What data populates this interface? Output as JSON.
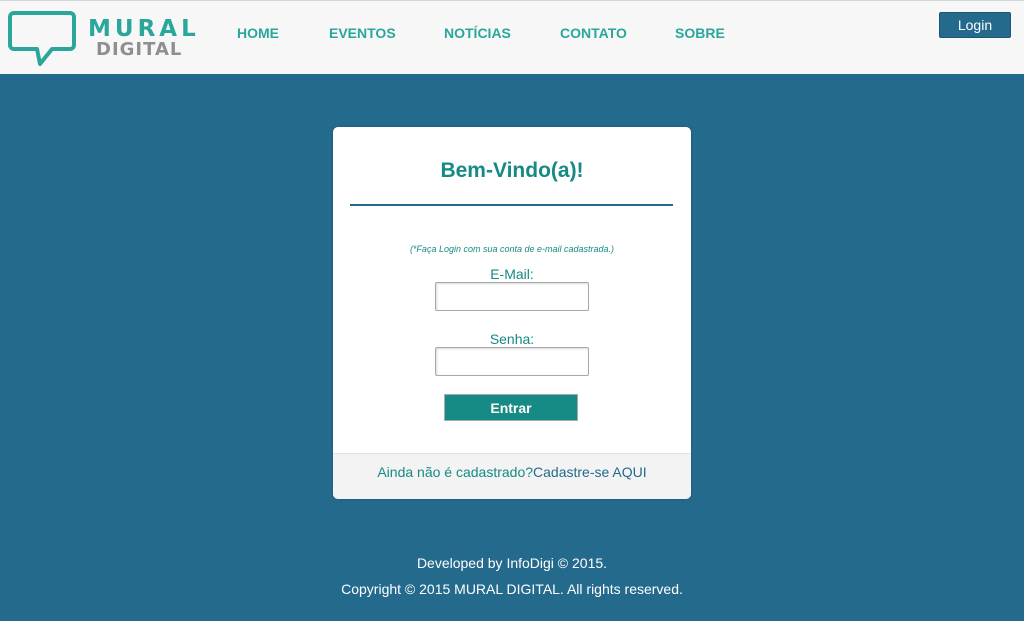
{
  "header": {
    "logo": {
      "line1": "MURAL",
      "line2": "DIGITAL"
    },
    "nav": [
      "HOME",
      "EVENTOS",
      "NOTÍCIAS",
      "CONTATO",
      "SOBRE"
    ],
    "login_label": "Login"
  },
  "login_card": {
    "title": "Bem-Vindo(a)!",
    "hint": "(*Faça Login com sua conta de e-mail cadastrada.)",
    "email_label": "E-Mail:",
    "email_value": "",
    "password_label": "Senha:",
    "password_value": "",
    "submit_label": "Entrar",
    "register_text": "Ainda não é cadastrado?",
    "register_link": "Cadastre-se AQUI"
  },
  "footer": {
    "line1": "Developed by InfoDigi © 2015.",
    "line2": "Copyright © 2015 MURAL DIGITAL. All rights reserved."
  },
  "colors": {
    "page_background": "#246a8c",
    "accent_teal": "#168a85",
    "nav_teal": "#2aa79a",
    "header_background": "#f7f7f7"
  }
}
